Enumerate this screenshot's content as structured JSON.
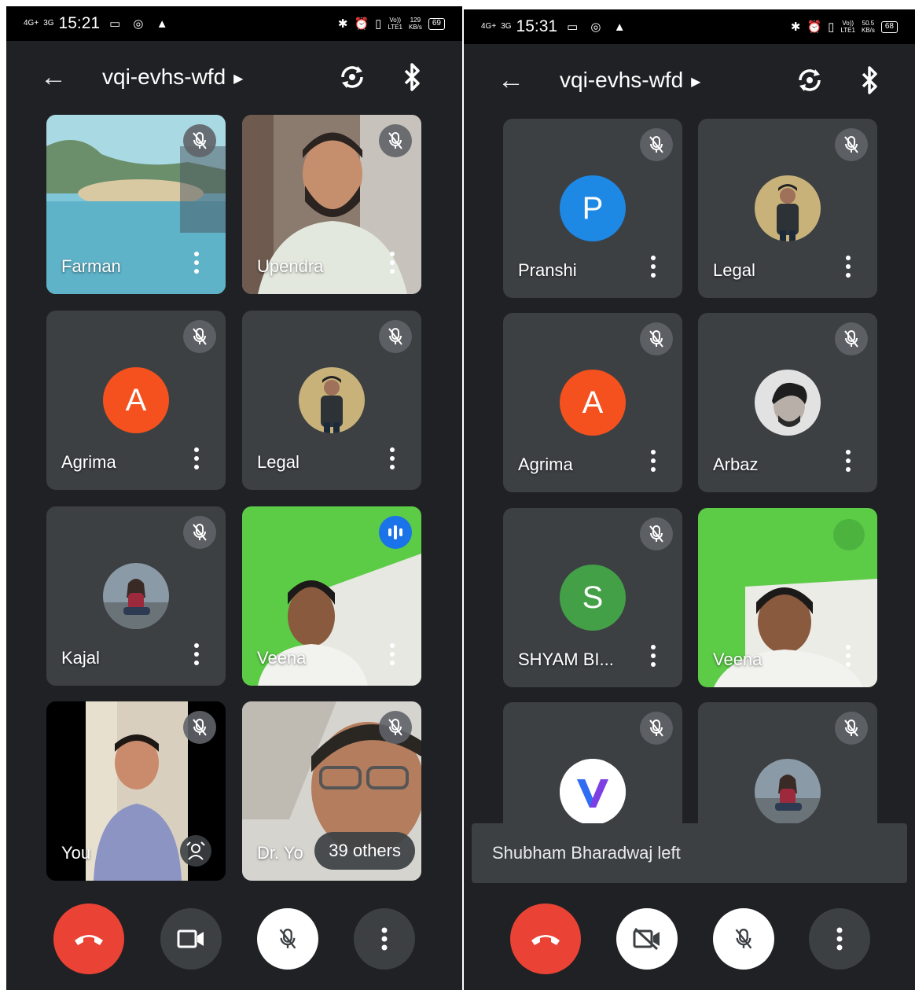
{
  "screens": [
    {
      "status": {
        "network1": "4G+",
        "network2": "3G",
        "time": "15:21",
        "net_speed": "129\nKB/s",
        "battery": "69",
        "volte": "Vo))\nLTE1"
      },
      "meeting_code": "vqi-evhs-wfd",
      "participants": [
        {
          "name": "Farman",
          "kind": "video-beach",
          "muted": true
        },
        {
          "name": "Upendra",
          "kind": "video-person",
          "muted": true
        },
        {
          "name": "Agrima",
          "kind": "letter",
          "letter": "A",
          "color": "#f4511e",
          "muted": true
        },
        {
          "name": "Legal",
          "kind": "photo-legal",
          "muted": true
        },
        {
          "name": "Kajal",
          "kind": "photo-kajal",
          "muted": true
        },
        {
          "name": "Veena",
          "kind": "video-veena",
          "speaking": true
        },
        {
          "name": "You",
          "kind": "self-video",
          "muted": true
        },
        {
          "name": "Dr. Yo",
          "kind": "video-dr",
          "muted": true,
          "overflow_label": "39 others"
        }
      ],
      "controls": {
        "camera": "on"
      }
    },
    {
      "status": {
        "network1": "4G+",
        "network2": "3G",
        "time": "15:31",
        "net_speed": "50.5\nKB/s",
        "battery": "68",
        "volte": "Vo))\nLTE1"
      },
      "meeting_code": "vqi-evhs-wfd",
      "participants": [
        {
          "name": "Pranshi",
          "kind": "letter",
          "letter": "P",
          "color": "#1e88e5",
          "muted": true
        },
        {
          "name": "Legal",
          "kind": "photo-legal",
          "muted": true
        },
        {
          "name": "Agrima",
          "kind": "letter",
          "letter": "A",
          "color": "#f4511e",
          "muted": true
        },
        {
          "name": "Arbaz",
          "kind": "photo-arbaz",
          "muted": true
        },
        {
          "name": "SHYAM BI...",
          "kind": "letter",
          "letter": "S",
          "color": "#43a047",
          "muted": true
        },
        {
          "name": "Veena",
          "kind": "video-veena2",
          "muted": false
        },
        {
          "name": "",
          "kind": "logo-v",
          "muted": true
        },
        {
          "name": "",
          "kind": "photo-kajal",
          "muted": true
        }
      ],
      "toast": "Shubham Bharadwaj left",
      "controls": {
        "camera": "off"
      }
    }
  ]
}
